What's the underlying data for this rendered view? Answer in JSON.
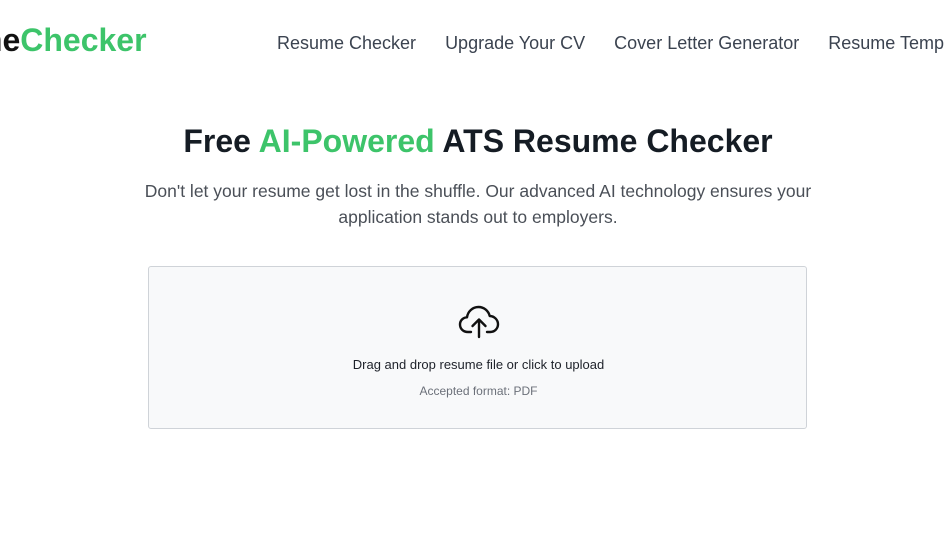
{
  "header": {
    "logo": {
      "prefix": "me",
      "accent": "Checker"
    },
    "nav": [
      "Resume Checker",
      "Upgrade Your CV",
      "Cover Letter Generator",
      "Resume Temp"
    ]
  },
  "hero": {
    "title_before": "Free ",
    "title_accent": "AI-Powered",
    "title_after": " ATS Resume Checker",
    "subtitle": "Don't let your resume get lost in the shuffle. Our advanced AI technology ensures your application stands out to employers."
  },
  "upload": {
    "icon": "cloud-upload-icon",
    "instruction": "Drag and drop resume file or click to upload",
    "format": "Accepted format: PDF"
  },
  "colors": {
    "accent": "#3dc46a",
    "text_dark": "#151c24",
    "nav_text": "#3b4350",
    "dropzone_bg": "#f8f9fa",
    "dropzone_border": "#cfd3d8"
  }
}
